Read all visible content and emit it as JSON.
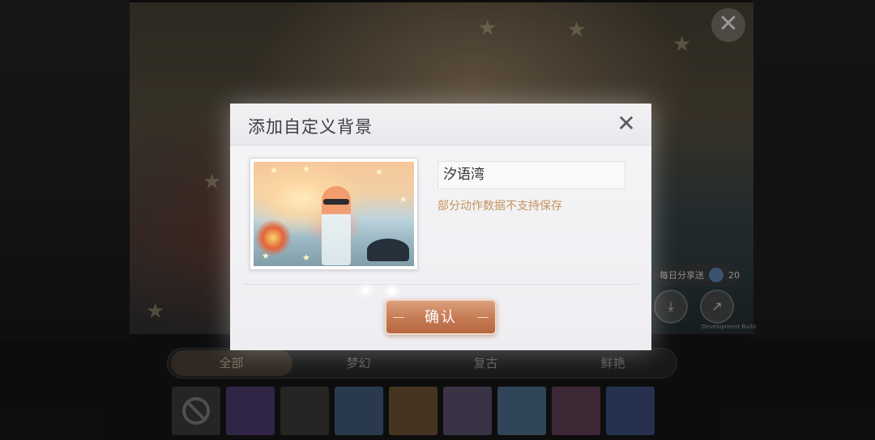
{
  "dialog": {
    "title": "添加自定义背景",
    "close_symbol": "✕",
    "name_value": "汐语湾",
    "warning": "部分动作数据不支持保存",
    "confirm_label": "确认"
  },
  "background": {
    "close_symbol": "✕",
    "share_label": "每日分享送",
    "share_count": "20",
    "dev_note": "Development Build",
    "tabs": [
      {
        "label": "全部",
        "active": true
      },
      {
        "label": "梦幻",
        "active": false
      },
      {
        "label": "复古",
        "active": false
      },
      {
        "label": "鲜艳",
        "active": false
      }
    ],
    "thumbnail_colors": [
      "#4a3a6a",
      "#3b3a37",
      "#3f5a78",
      "#6a5030",
      "#5a4f6a",
      "#4a6a86",
      "#5e3f52",
      "#3a4c7a"
    ]
  },
  "icons": {
    "download": "download-icon",
    "share": "share-icon",
    "no_background": "no-background-icon"
  }
}
